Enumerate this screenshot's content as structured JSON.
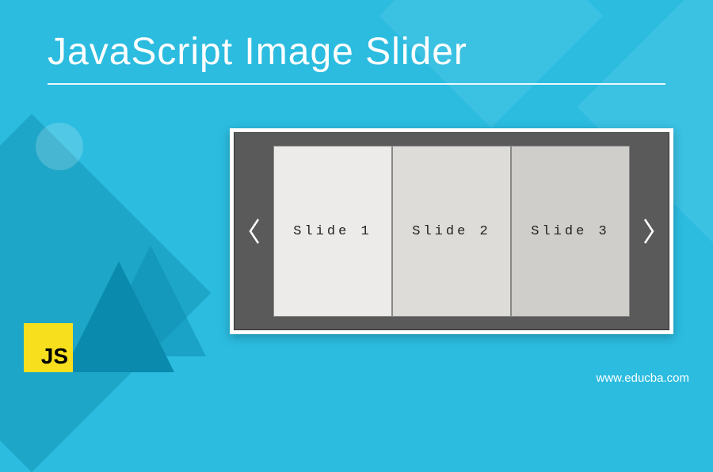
{
  "title": "JavaScript Image Slider",
  "slider": {
    "slides": [
      {
        "label": "Slide 1"
      },
      {
        "label": "Slide 2"
      },
      {
        "label": "Slide 3"
      }
    ]
  },
  "logo": {
    "text": "JS"
  },
  "watermark": "www.educba.com"
}
